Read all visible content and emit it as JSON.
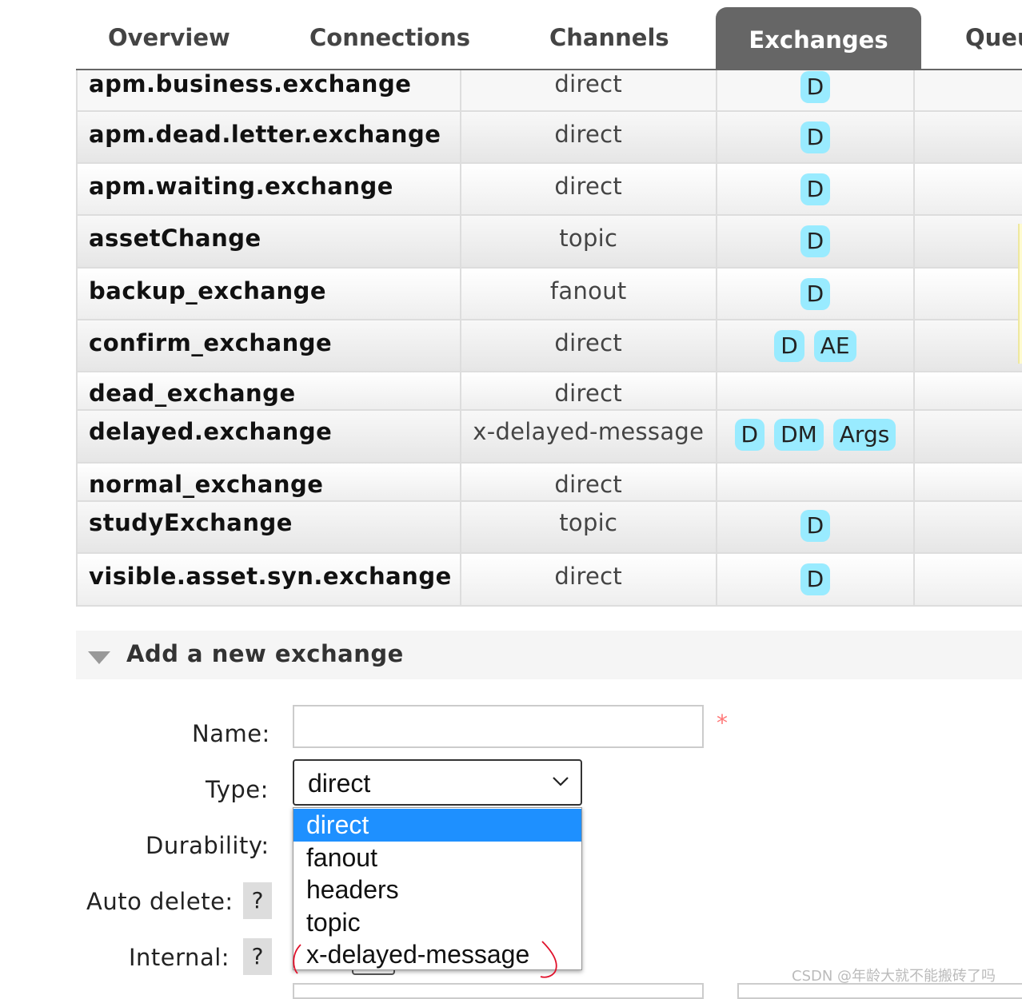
{
  "nav": {
    "tabs": [
      {
        "label": "Overview"
      },
      {
        "label": "Connections"
      },
      {
        "label": "Channels"
      },
      {
        "label": "Exchanges",
        "active": true
      },
      {
        "label": "Queu"
      }
    ]
  },
  "exchanges": {
    "rows": [
      {
        "name": "apm.business.exchange",
        "type": "direct",
        "features": [
          "D"
        ]
      },
      {
        "name": "apm.dead.letter.exchange",
        "type": "direct",
        "features": [
          "D"
        ]
      },
      {
        "name": "apm.waiting.exchange",
        "type": "direct",
        "features": [
          "D"
        ]
      },
      {
        "name": "assetChange",
        "type": "topic",
        "features": [
          "D"
        ]
      },
      {
        "name": "backup_exchange",
        "type": "fanout",
        "features": [
          "D"
        ]
      },
      {
        "name": "confirm_exchange",
        "type": "direct",
        "features": [
          "D",
          "AE"
        ]
      },
      {
        "name": "dead_exchange",
        "type": "direct",
        "features": []
      },
      {
        "name": "delayed.exchange",
        "type": "x-delayed-message",
        "features": [
          "D",
          "DM",
          "Args"
        ]
      },
      {
        "name": "normal_exchange",
        "type": "direct",
        "features": []
      },
      {
        "name": "studyExchange",
        "type": "topic",
        "features": [
          "D"
        ]
      },
      {
        "name": "visible.asset.syn.exchange",
        "type": "direct",
        "features": [
          "D"
        ]
      }
    ]
  },
  "add_exchange": {
    "title": "Add a new exchange",
    "name_label": "Name:",
    "name_value": "",
    "required_mark": "*",
    "type_label": "Type:",
    "type_value": "direct",
    "type_options": [
      "direct",
      "fanout",
      "headers",
      "topic",
      "x-delayed-message"
    ],
    "durability_label": "Durability:",
    "auto_delete_label": "Auto delete:",
    "internal_label": "Internal:",
    "help_glyph": "?"
  },
  "watermark": "CSDN @年龄大就不能搬砖了吗",
  "colors": {
    "active_tab": "#666666",
    "badge": "#99ebff",
    "selected_option": "#1e90ff",
    "annotation": "#e0102a"
  },
  "icons": [
    "chevron-down-icon",
    "collapse-triangle-icon"
  ]
}
